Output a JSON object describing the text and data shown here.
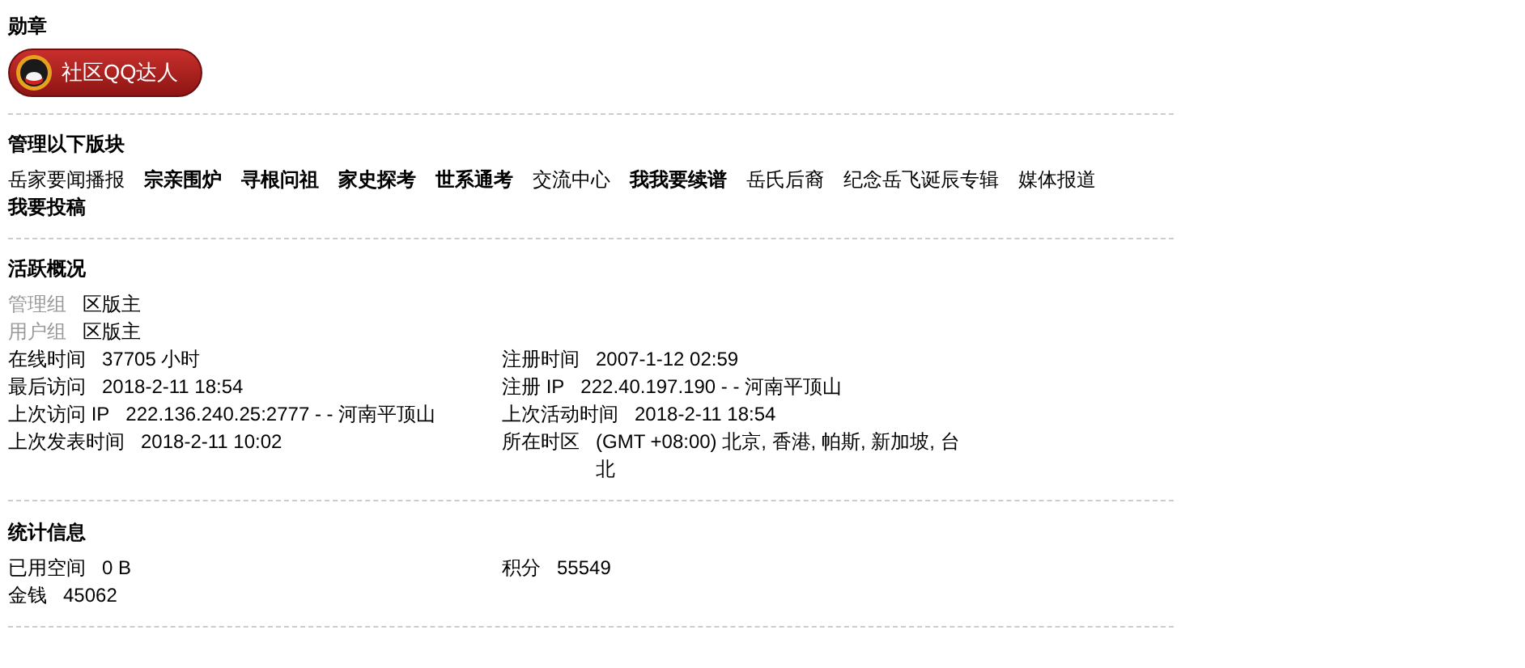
{
  "medals": {
    "title": "勋章",
    "badges": [
      {
        "label": "社区QQ达人"
      }
    ]
  },
  "forums": {
    "title": "管理以下版块",
    "items": [
      {
        "label": "岳家要闻播报",
        "bold": false
      },
      {
        "label": "宗亲围炉",
        "bold": true
      },
      {
        "label": "寻根问祖",
        "bold": true
      },
      {
        "label": "家史探考",
        "bold": true
      },
      {
        "label": "世系通考",
        "bold": true
      },
      {
        "label": "交流中心",
        "bold": false
      },
      {
        "label": "我我要续谱",
        "bold": true
      },
      {
        "label": "岳氏后裔",
        "bold": false
      },
      {
        "label": "纪念岳飞诞辰专辑",
        "bold": false
      },
      {
        "label": "媒体报道",
        "bold": false
      },
      {
        "label": "我要投稿",
        "bold": true
      }
    ]
  },
  "activity": {
    "title": "活跃概况",
    "groups": [
      {
        "label": "管理组",
        "value": "区版主"
      },
      {
        "label": "用户组",
        "value": "区版主"
      }
    ],
    "rows": [
      [
        {
          "label": "在线时间",
          "value": "37705 小时"
        },
        {
          "label": "注册时间",
          "value": "2007-1-12 02:59"
        }
      ],
      [
        {
          "label": "最后访问",
          "value": "2018-2-11 18:54"
        },
        {
          "label": "注册 IP",
          "value": "222.40.197.190 - - 河南平顶山"
        }
      ],
      [
        {
          "label": "上次访问 IP",
          "value": "222.136.240.25:2777 - - 河南平顶山"
        },
        {
          "label": "上次活动时间",
          "value": "2018-2-11 18:54"
        }
      ],
      [
        {
          "label": "上次发表时间",
          "value": "2018-2-11 10:02"
        },
        {
          "label": "所在时区",
          "value": "(GMT +08:00) 北京, 香港, 帕斯, 新加坡, 台北"
        }
      ]
    ]
  },
  "stats": {
    "title": "统计信息",
    "rows": [
      [
        {
          "label": "已用空间",
          "value": "0 B"
        },
        {
          "label": "积分",
          "value": "55549"
        }
      ],
      [
        {
          "label": "金钱",
          "value": "45062"
        }
      ]
    ]
  }
}
